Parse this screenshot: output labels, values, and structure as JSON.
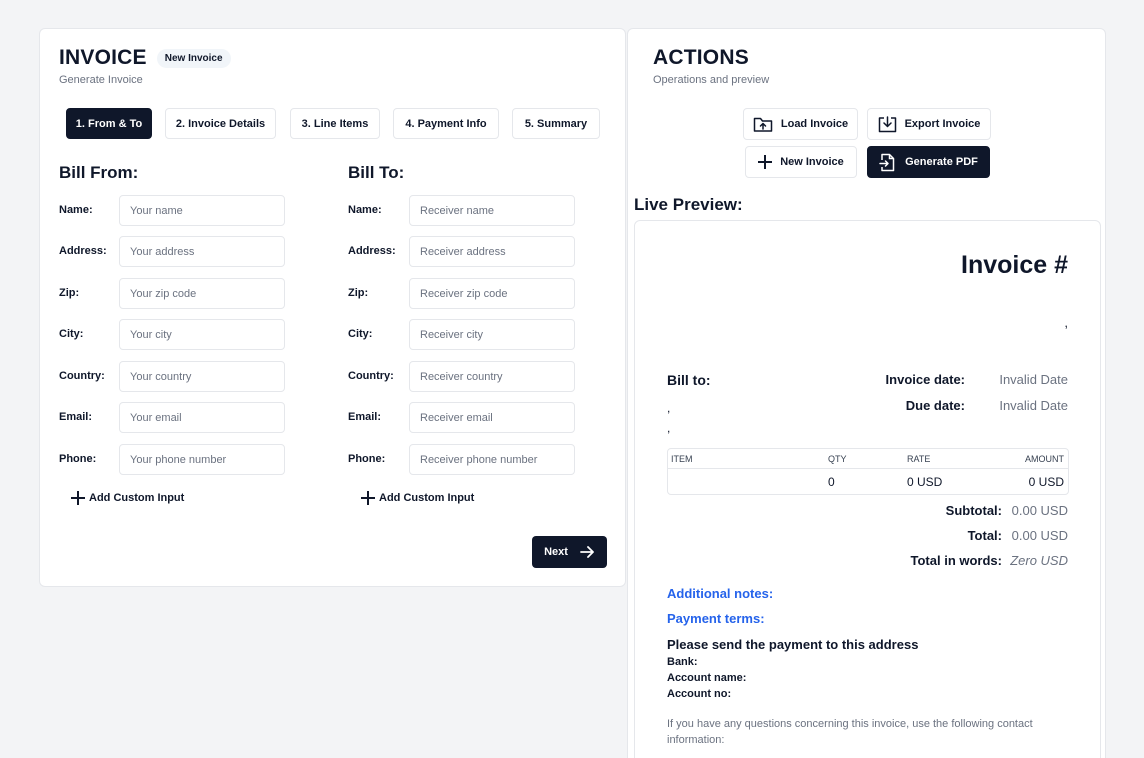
{
  "left": {
    "title": "INVOICE",
    "badge": "New Invoice",
    "subtitle": "Generate Invoice",
    "tabs": [
      "1. From & To",
      "2. Invoice Details",
      "3. Line Items",
      "4. Payment Info",
      "5. Summary"
    ],
    "active_tab": 0,
    "bill_from": {
      "heading": "Bill From:",
      "fields": [
        {
          "label": "Name:",
          "placeholder": "Your name"
        },
        {
          "label": "Address:",
          "placeholder": "Your address"
        },
        {
          "label": "Zip:",
          "placeholder": "Your zip code"
        },
        {
          "label": "City:",
          "placeholder": "Your city"
        },
        {
          "label": "Country:",
          "placeholder": "Your country"
        },
        {
          "label": "Email:",
          "placeholder": "Your email"
        },
        {
          "label": "Phone:",
          "placeholder": "Your phone number"
        }
      ],
      "add_custom": "Add Custom Input"
    },
    "bill_to": {
      "heading": "Bill To:",
      "fields": [
        {
          "label": "Name:",
          "placeholder": "Receiver name"
        },
        {
          "label": "Address:",
          "placeholder": "Receiver address"
        },
        {
          "label": "Zip:",
          "placeholder": "Receiver zip code"
        },
        {
          "label": "City:",
          "placeholder": "Receiver city"
        },
        {
          "label": "Country:",
          "placeholder": "Receiver country"
        },
        {
          "label": "Email:",
          "placeholder": "Receiver email"
        },
        {
          "label": "Phone:",
          "placeholder": "Receiver phone number"
        }
      ],
      "add_custom": "Add Custom Input"
    },
    "next_label": "Next"
  },
  "right": {
    "title": "ACTIONS",
    "subtitle": "Operations and preview",
    "buttons": {
      "load": "Load Invoice",
      "export": "Export Invoice",
      "new": "New Invoice",
      "generate": "Generate PDF"
    },
    "live_preview_label": "Live Preview:"
  },
  "preview": {
    "invoice_title": "Invoice #",
    "comma": ",",
    "bill_to_label": "Bill to:",
    "invoice_date_label": "Invoice date:",
    "invoice_date_value": "Invalid Date",
    "due_date_label": "Due date:",
    "due_date_value": "Invalid Date",
    "table": {
      "headers": [
        "ITEM",
        "QTY",
        "RATE",
        "AMOUNT"
      ],
      "row": [
        "",
        "0",
        "0 USD",
        "0 USD"
      ]
    },
    "subtotal_label": "Subtotal:",
    "subtotal_value": "0.00 USD",
    "total_label": "Total:",
    "total_value": "0.00 USD",
    "words_label": "Total in words:",
    "words_value": "Zero USD",
    "additional_notes": "Additional notes:",
    "payment_terms": "Payment terms:",
    "send_payment": "Please send the payment to this address",
    "bank": "Bank:",
    "account_name": "Account name:",
    "account_no": "Account no:",
    "contact_text": "If you have any questions concerning this invoice, use the following contact information:"
  },
  "colors": {
    "dark": "#0f172a",
    "link": "#2563eb",
    "muted": "#6b7280",
    "border": "#e5e7eb"
  }
}
